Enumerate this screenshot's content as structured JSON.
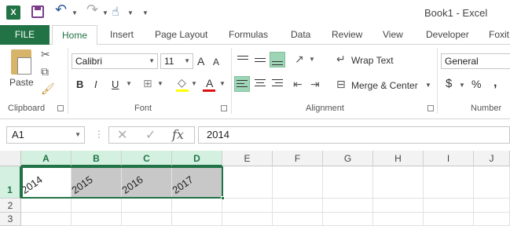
{
  "titlebar": {
    "title": "Book1 - Excel",
    "logo_letter": "X",
    "icons": [
      "excel-logo",
      "save-icon",
      "undo-icon",
      "redo-icon",
      "touch-mode-icon",
      "customize-qat-icon"
    ]
  },
  "tabs": {
    "file": "FILE",
    "items": [
      "Home",
      "Insert",
      "Page Layout",
      "Formulas",
      "Data",
      "Review",
      "View",
      "Developer",
      "Foxit"
    ]
  },
  "ribbon": {
    "clipboard": {
      "paste": "Paste",
      "label": "Clipboard"
    },
    "font": {
      "name": "Calibri",
      "size": "11",
      "bold": "B",
      "italic": "I",
      "underline": "U",
      "grow": "A",
      "shrink": "A",
      "color": "A",
      "label": "Font"
    },
    "alignment": {
      "wrap_text": "Wrap Text",
      "merge_center": "Merge & Center",
      "label": "Alignment"
    },
    "number": {
      "format": "General",
      "currency": "$",
      "percent": "%",
      "comma": ",",
      "label": "Number"
    }
  },
  "formula_bar": {
    "name_box": "A1",
    "value": "2014",
    "fx": "fx"
  },
  "grid": {
    "columns": [
      "A",
      "B",
      "C",
      "D",
      "E",
      "F",
      "G",
      "H",
      "I",
      "J"
    ],
    "rows": [
      "1",
      "2",
      "3"
    ],
    "row1": [
      "2014",
      "2015",
      "2016",
      "2017"
    ]
  },
  "colors": {
    "accent": "#217346",
    "selection_fill": "#c8c8c8",
    "header_selected": "#d3f0e0"
  }
}
